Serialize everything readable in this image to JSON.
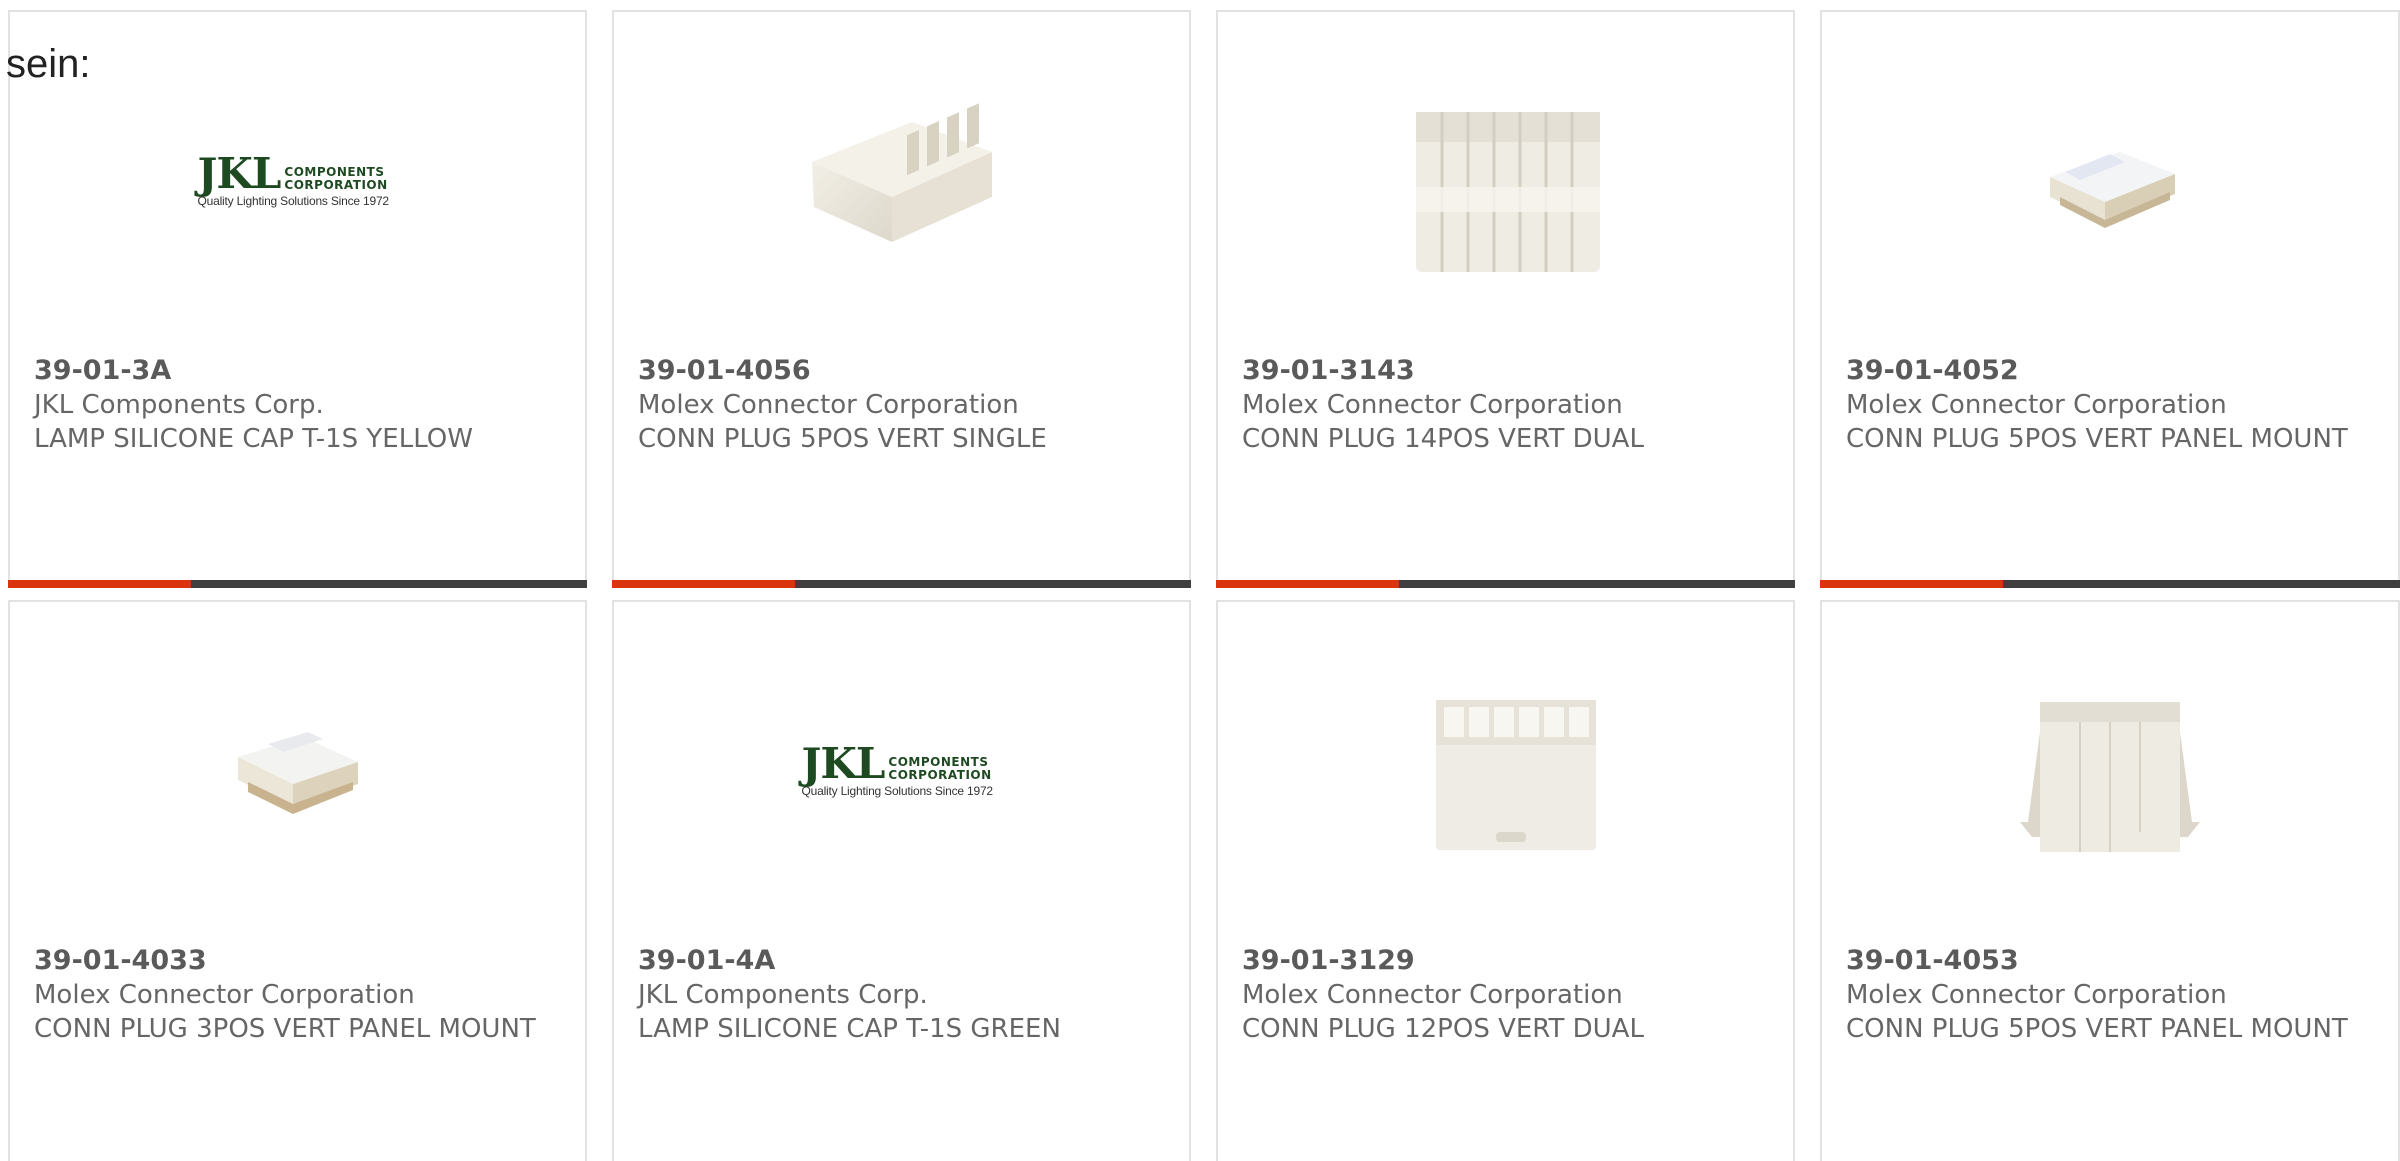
{
  "prefix_text": "sein:",
  "colors": {
    "card_border": "#e2e2e2",
    "bar_dark": "#3f3f3f",
    "bar_accent": "#d9340f",
    "text": "#666666"
  },
  "jkl_logo": {
    "name": "JKL",
    "line1": "COMPONENTS",
    "line2": "CORPORATION",
    "tagline": "Quality Lighting Solutions Since 1972"
  },
  "products": [
    {
      "part_number": "39-01-3A",
      "manufacturer": "JKL Components Corp.",
      "description": "LAMP SILICONE CAP T-1S YELLOW",
      "image": "jkl-logo"
    },
    {
      "part_number": "39-01-4056",
      "manufacturer": "Molex Connector Corporation",
      "description": "CONN PLUG 5POS VERT SINGLE",
      "image": "connector-plug-5pos"
    },
    {
      "part_number": "39-01-3143",
      "manufacturer": "Molex Connector Corporation",
      "description": "CONN PLUG 14POS VERT DUAL",
      "image": "connector-plug-14pos"
    },
    {
      "part_number": "39-01-4052",
      "manufacturer": "Molex Connector Corporation",
      "description": "CONN PLUG 5POS VERT PANEL MOUNT",
      "image": "connector-plug-panel"
    },
    {
      "part_number": "39-01-4033",
      "manufacturer": "Molex Connector Corporation",
      "description": "CONN PLUG 3POS VERT PANEL MOUNT",
      "image": "connector-plug-panel"
    },
    {
      "part_number": "39-01-4A",
      "manufacturer": "JKL Components Corp.",
      "description": "LAMP SILICONE CAP T-1S GREEN",
      "image": "jkl-logo"
    },
    {
      "part_number": "39-01-3129",
      "manufacturer": "Molex Connector Corporation",
      "description": "CONN PLUG 12POS VERT DUAL",
      "image": "connector-plug-12pos"
    },
    {
      "part_number": "39-01-4053",
      "manufacturer": "Molex Connector Corporation",
      "description": "CONN PLUG 5POS VERT PANEL MOUNT",
      "image": "connector-plug-latch"
    }
  ]
}
